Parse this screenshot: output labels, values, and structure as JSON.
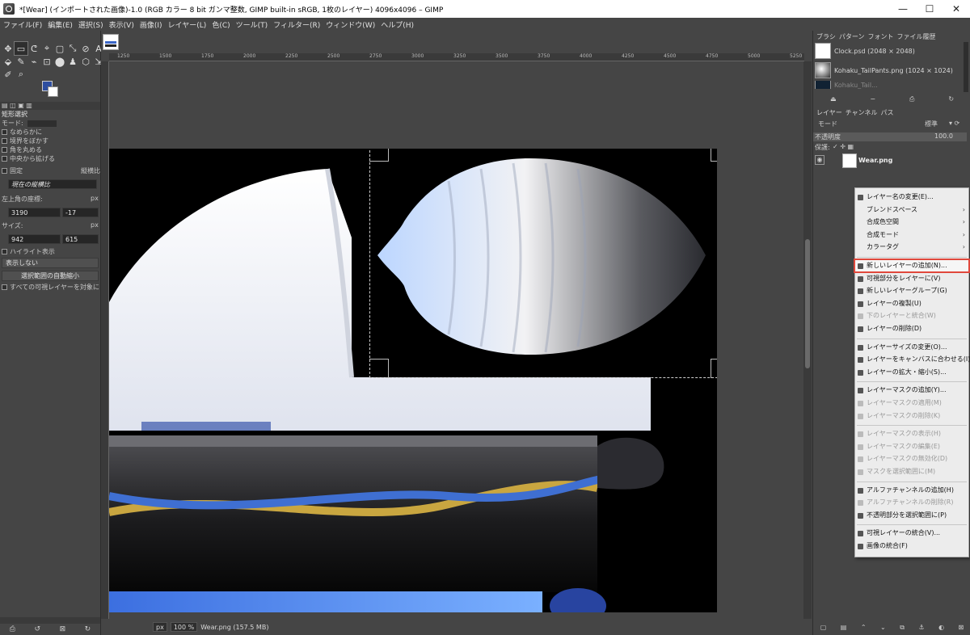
{
  "window": {
    "title": "*[Wear] (インポートされた画像)-1.0 (RGB カラー 8 bit ガンマ整数, GIMP built-in sRGB, 1枚のレイヤー) 4096x4096 – GIMP",
    "minimize": "—",
    "maximize": "☐",
    "close": "✕"
  },
  "menubar": [
    "ファイル(F)",
    "編集(E)",
    "選択(S)",
    "表示(V)",
    "画像(I)",
    "レイヤー(L)",
    "色(C)",
    "ツール(T)",
    "フィルター(R)",
    "ウィンドウ(W)",
    "ヘルプ(H)"
  ],
  "toolbox": {
    "rows": [
      [
        "✥",
        "▭",
        "ᕦ",
        "⌖",
        "▢",
        "⤡",
        "⊘",
        "A"
      ],
      [
        "⬙",
        "✎",
        "⌁",
        "⊡",
        "⬤",
        "♟",
        "⬡",
        "⇲"
      ],
      [
        "✐",
        "⌕"
      ]
    ],
    "fg_color": "#2e4ea0",
    "bg_color": "#ffffff"
  },
  "tool_options": {
    "tool_name": "矩形選択",
    "mode_label": "モード:",
    "antialias": "なめらかに",
    "feather": "境界をぼかす",
    "rounded": "角を丸める",
    "expand_center": "中央から拡げる",
    "fixed": "固定",
    "fixed_type": "縦横比",
    "fixed_value": "現在の縦横比",
    "position_label": "左上角の座標:",
    "position_unit": "px",
    "pos_x": "3190",
    "pos_y": "-17",
    "size_label": "サイズ:",
    "size_unit": "px",
    "size_w": "942",
    "size_h": "615",
    "highlight": "ハイライト表示",
    "guides": "表示しない",
    "autoshrink": "選択範囲の自動縮小",
    "shrink_merged": "すべての可視レイヤーを対象に"
  },
  "ruler": {
    "ticks": [
      "1250",
      "1500",
      "1750",
      "2000",
      "2250",
      "2500",
      "2750",
      "3000",
      "3250",
      "3500",
      "3750",
      "4000",
      "4250",
      "4500",
      "4750",
      "5000",
      "5250"
    ]
  },
  "status": {
    "unit": "px",
    "zoom": "100 %",
    "info": "Wear.png (157.5 MB)"
  },
  "right_dock": {
    "tabs_top": [
      "ブラシ",
      "パターン",
      "フォント",
      "ファイル履歴"
    ],
    "images": [
      {
        "name": "Clock.psd (2048 × 2048)"
      },
      {
        "name": "Kohaku_TailPants.png (1024 × 1024)"
      },
      {
        "name": "Kohaku_Tail..."
      }
    ],
    "tabs_layers": [
      "レイヤー",
      "チャンネル",
      "パス"
    ],
    "mode_label": "モード",
    "mode_value": "標準",
    "opacity_label": "不透明度",
    "opacity_value": "100.0",
    "lock_label": "保護:",
    "layer_name": "Wear.png"
  },
  "context_menu": {
    "items": [
      {
        "label": "レイヤー名の変更(E)...",
        "disabled": false,
        "submenu": false
      },
      {
        "label": "ブレンドスペース",
        "disabled": false,
        "submenu": true
      },
      {
        "label": "合成色空間",
        "disabled": false,
        "submenu": true
      },
      {
        "label": "合成モード",
        "disabled": false,
        "submenu": true
      },
      {
        "label": "カラータグ",
        "disabled": false,
        "submenu": true
      },
      {
        "label": "新しいレイヤーの追加(N)...",
        "disabled": false,
        "submenu": false,
        "highlight": true
      },
      {
        "label": "可視部分をレイヤーに(V)",
        "disabled": false,
        "submenu": false
      },
      {
        "label": "新しいレイヤーグループ(G)",
        "disabled": false,
        "submenu": false
      },
      {
        "label": "レイヤーの複製(U)",
        "disabled": false,
        "submenu": false
      },
      {
        "label": "下のレイヤーと統合(W)",
        "disabled": true,
        "submenu": false
      },
      {
        "label": "レイヤーの削除(D)",
        "disabled": false,
        "submenu": false
      },
      {
        "label": "レイヤーサイズの変更(O)...",
        "disabled": false,
        "submenu": false
      },
      {
        "label": "レイヤーをキャンバスに合わせる(I)",
        "disabled": false,
        "submenu": false
      },
      {
        "label": "レイヤーの拡大・縮小(S)...",
        "disabled": false,
        "submenu": false
      },
      {
        "label": "レイヤーマスクの追加(Y)...",
        "disabled": false,
        "submenu": false
      },
      {
        "label": "レイヤーマスクの適用(M)",
        "disabled": true,
        "submenu": false
      },
      {
        "label": "レイヤーマスクの削除(K)",
        "disabled": true,
        "submenu": false
      },
      {
        "label": "レイヤーマスクの表示(H)",
        "disabled": true,
        "submenu": false
      },
      {
        "label": "レイヤーマスクの編集(E)",
        "disabled": true,
        "submenu": false
      },
      {
        "label": "レイヤーマスクの無効化(D)",
        "disabled": true,
        "submenu": false
      },
      {
        "label": "マスクを選択範囲に(M)",
        "disabled": true,
        "submenu": false
      },
      {
        "label": "アルファチャンネルの追加(H)",
        "disabled": false,
        "submenu": false
      },
      {
        "label": "アルファチャンネルの削除(R)",
        "disabled": true,
        "submenu": false
      },
      {
        "label": "不透明部分を選択範囲に(P)",
        "disabled": false,
        "submenu": false
      },
      {
        "label": "可視レイヤーの統合(V)...",
        "disabled": false,
        "submenu": false
      },
      {
        "label": "画像の統合(F)",
        "disabled": false,
        "submenu": false
      }
    ],
    "highlight_color": "#e0483c"
  }
}
